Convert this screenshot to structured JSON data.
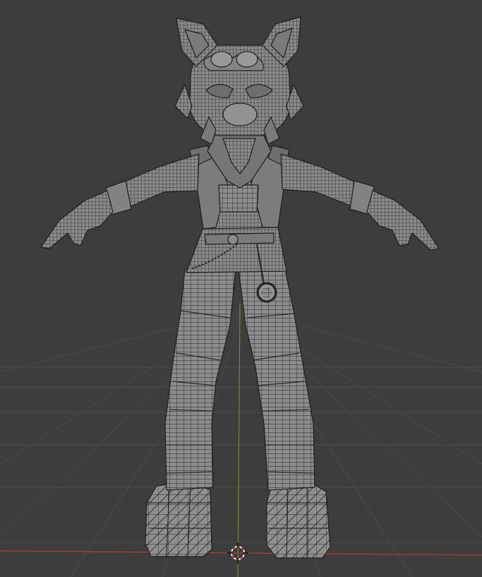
{
  "viewport": {
    "mode": "3d-viewport-wireframe-overlay",
    "background_color": "#3d3d3d",
    "grid_color": "#4a4a4a",
    "x_axis_color": "#b43c3c",
    "y_axis_color": "#6e8c28",
    "mesh_fill_color": "#8a8a8a",
    "mesh_wire_color": "#1e1e1e",
    "cursor_icon": "3d-cursor-icon"
  }
}
